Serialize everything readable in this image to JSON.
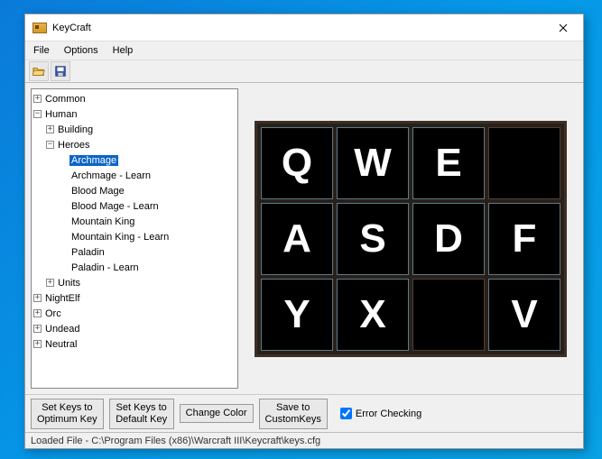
{
  "window": {
    "title": "KeyCraft"
  },
  "menu": {
    "file": "File",
    "options": "Options",
    "help": "Help"
  },
  "tree": {
    "common": "Common",
    "human": "Human",
    "building": "Building",
    "heroes": "Heroes",
    "archmage": "Archmage",
    "archmage_learn": "Archmage - Learn",
    "bloodmage": "Blood Mage",
    "bloodmage_learn": "Blood Mage - Learn",
    "mountainking": "Mountain King",
    "mountainking_learn": "Mountain King - Learn",
    "paladin": "Paladin",
    "paladin_learn": "Paladin - Learn",
    "units": "Units",
    "nightelf": "NightElf",
    "orc": "Orc",
    "undead": "Undead",
    "neutral": "Neutral"
  },
  "grid": {
    "r0c0": "Q",
    "r0c1": "W",
    "r0c2": "E",
    "r0c3": "",
    "r1c0": "A",
    "r1c1": "S",
    "r1c2": "D",
    "r1c3": "F",
    "r2c0": "Y",
    "r2c1": "X",
    "r2c2": "",
    "r2c3": "V"
  },
  "buttons": {
    "optimum": "Set Keys to\nOptimum Key",
    "default": "Set Keys to\nDefault Key",
    "color": "Change Color",
    "save": "Save to\nCustomKeys",
    "errorchk": "Error Checking"
  },
  "status": "Loaded File - C:\\Program Files (x86)\\Warcraft III\\Keycraft\\keys.cfg"
}
